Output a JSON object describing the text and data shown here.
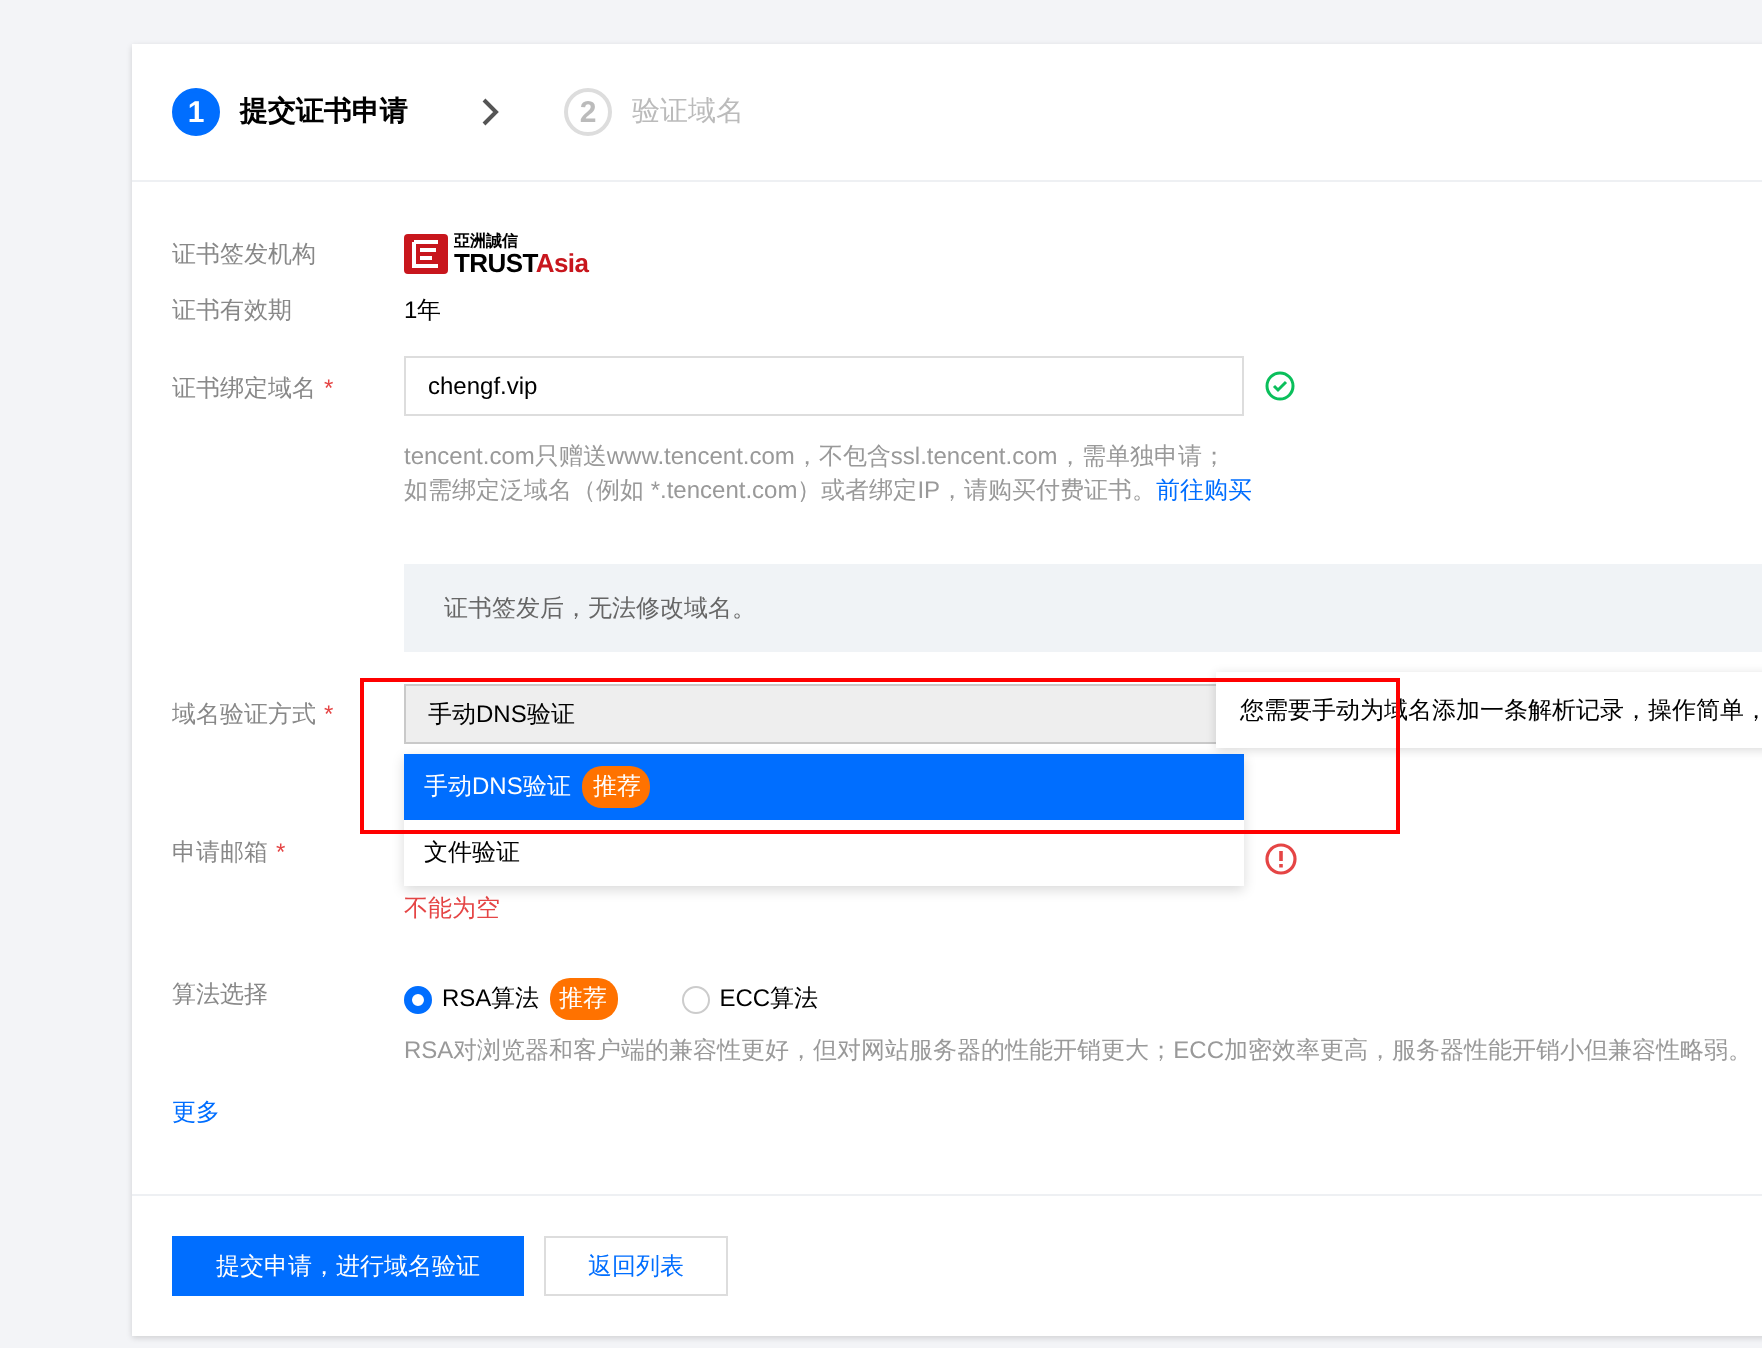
{
  "steps": [
    {
      "number": "1",
      "label": "提交证书申请",
      "selected": true
    },
    {
      "number": "2",
      "label": "验证域名",
      "selected": false
    }
  ],
  "issuer": {
    "label": "证书签发机构",
    "logo_cn": "亞洲誠信",
    "logo_a": "TRUST",
    "logo_b": "Asia"
  },
  "validity": {
    "label": "证书有效期",
    "value": "1年"
  },
  "domain": {
    "label": "证书绑定域名",
    "required_mark": "*",
    "value": "chengf.vip",
    "valid": true,
    "help_1": "tencent.com只赠送www.tencent.com，不包含ssl.tencent.com，需单独申请；",
    "help_2": "如需绑定泛域名（例如 *.tencent.com）或者绑定IP，请购买付费证书。",
    "help_link": "前往购买"
  },
  "notice": "证书签发后，无法修改域名。",
  "verify": {
    "label": "域名验证方式",
    "required_mark": "*",
    "value": "手动DNS验证",
    "expanded": true,
    "options": [
      {
        "label": "手动DNS验证",
        "badge": "推荐",
        "selected": true
      },
      {
        "label": "文件验证",
        "selected": false
      }
    ],
    "tooltip": "您需要手动为域名添加一条解析记录，操作简单，"
  },
  "email": {
    "label": "申请邮箱",
    "required_mark": "*",
    "invalid": true,
    "error": "不能为空"
  },
  "algorithm": {
    "label": "算法选择",
    "options": [
      {
        "label": "RSA算法",
        "badge": "推荐",
        "selected": true
      },
      {
        "label": "ECC算法",
        "selected": false
      }
    ],
    "help": "RSA对浏览器和客户端的兼容性更好，但对网站服务器的性能开销更大；ECC加密效率更高，服务器性能开销小但兼容性略弱。"
  },
  "more": "更多",
  "buttons": [
    {
      "label": "提交申请，进行域名验证",
      "kind": "primary"
    },
    {
      "label": "返回列表",
      "kind": "secondary"
    }
  ]
}
